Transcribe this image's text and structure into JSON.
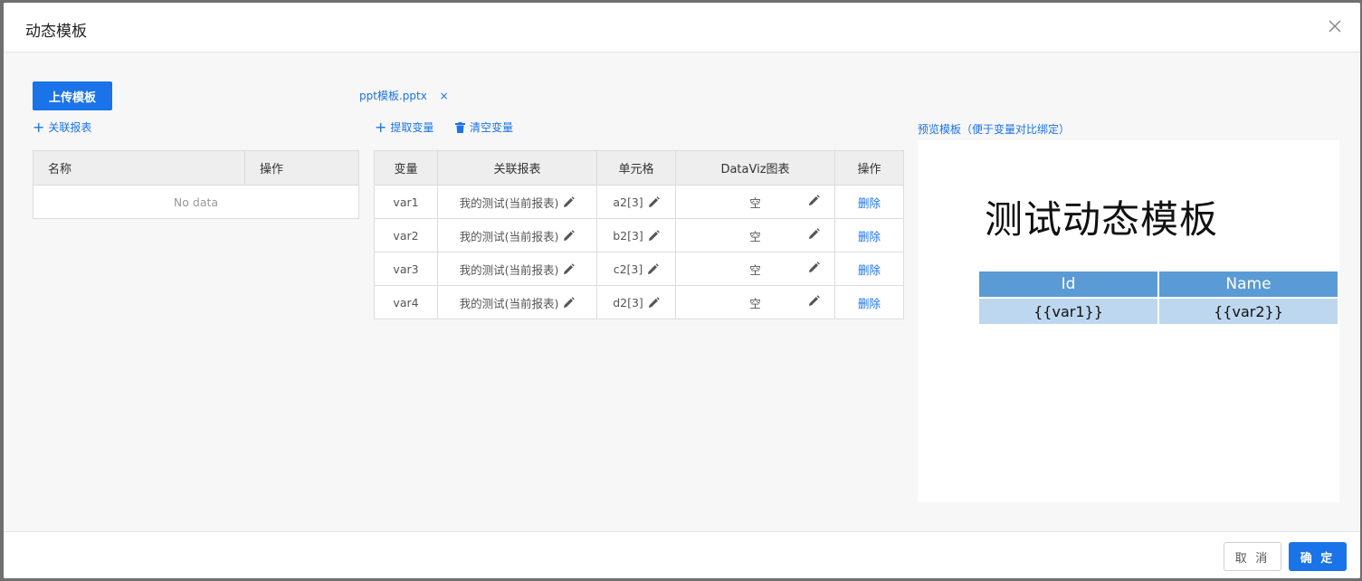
{
  "dialog": {
    "title": "动态模板",
    "close_icon": "close-icon"
  },
  "toolbar": {
    "upload_label": "上传模板",
    "file_name": "ppt模板.pptx",
    "file_remove": "×",
    "associate_label": "关联报表",
    "extract_label": "提取变量",
    "clear_label": "清空变量"
  },
  "left_table": {
    "headers": [
      "名称",
      "操作"
    ],
    "empty_text": "No data"
  },
  "var_table": {
    "headers": [
      "变量",
      "关联报表",
      "单元格",
      "DataViz图表",
      "操作"
    ],
    "rows": [
      {
        "var": "var1",
        "report": "我的测试(当前报表)",
        "cell": "a2[3]",
        "dataviz": "空",
        "action": "删除"
      },
      {
        "var": "var2",
        "report": "我的测试(当前报表)",
        "cell": "b2[3]",
        "dataviz": "空",
        "action": "删除"
      },
      {
        "var": "var3",
        "report": "我的测试(当前报表)",
        "cell": "c2[3]",
        "dataviz": "空",
        "action": "删除"
      },
      {
        "var": "var4",
        "report": "我的测试(当前报表)",
        "cell": "d2[3]",
        "dataviz": "空",
        "action": "删除"
      }
    ]
  },
  "preview": {
    "label": "预览模板（便于变量对比绑定）",
    "slide_title": "测试动态模板",
    "table_headers": [
      "Id",
      "Name"
    ],
    "table_row": [
      "{{var1}}",
      "{{var2}}"
    ]
  },
  "footer": {
    "cancel_label": "取 消",
    "ok_label": "确 定"
  },
  "colors": {
    "accent": "#1a73e8",
    "slide_header": "#5b9bd5",
    "slide_cell": "#bdd7ee"
  }
}
